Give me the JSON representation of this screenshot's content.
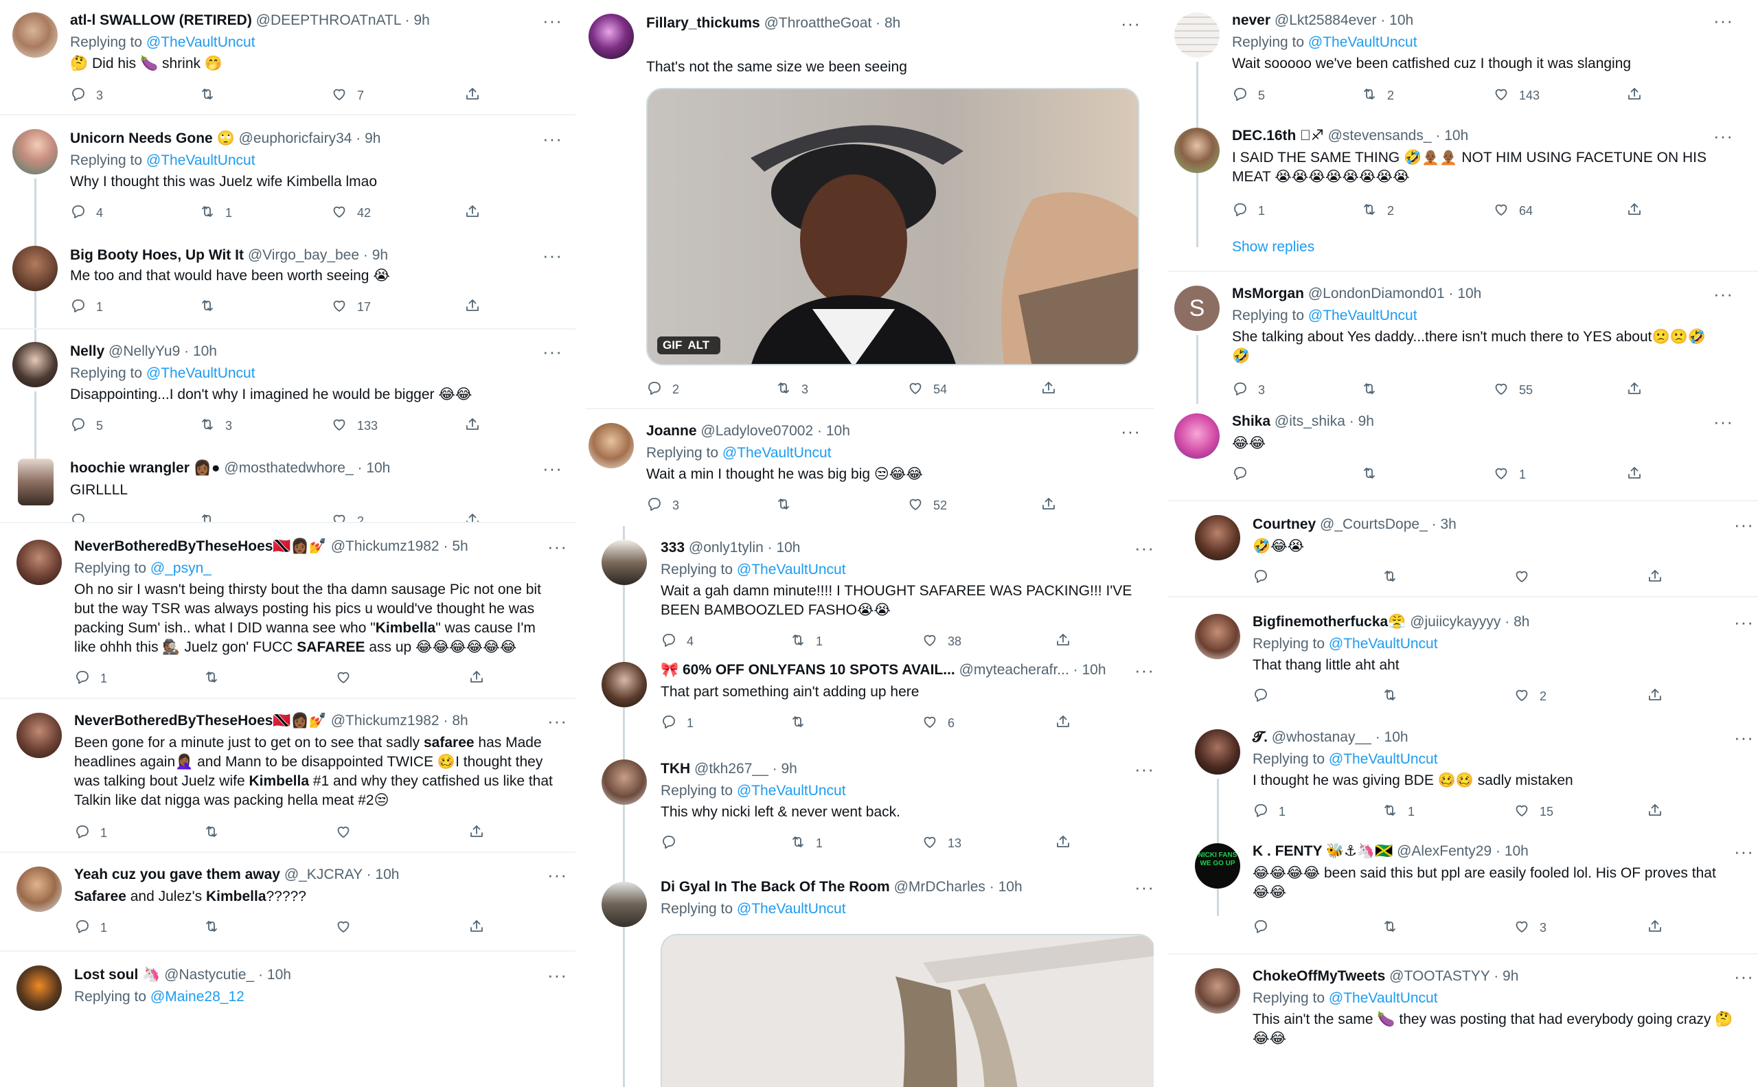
{
  "colors": {
    "link": "#1d9bf0",
    "muted": "#536471",
    "text": "#0f1419",
    "divider": "#eff3f4"
  },
  "icons": {
    "reply": "reply-icon",
    "retweet": "retweet-icon",
    "like": "heart-icon",
    "share": "share-icon",
    "more": "more-icon"
  },
  "col1": [
    {
      "name": "atl-l SWALLOW (RETIRED)",
      "handle": "@DEEPTHROATnATL",
      "time": "9h",
      "replying": "@TheVaultUncut",
      "text": "🤔 Did his 🍆 shrink 🤭",
      "replies": "3",
      "retweets": "",
      "likes": "7"
    },
    {
      "name": "Unicorn Needs Gone 🙄",
      "handle": "@euphoricfairy34",
      "time": "9h",
      "replying": "@TheVaultUncut",
      "text": "Why I thought this was Juelz wife Kimbella lmao",
      "replies": "4",
      "retweets": "1",
      "likes": "42"
    },
    {
      "name": "Big Booty Hoes, Up Wit It",
      "handle": "@Virgo_bay_bee",
      "time": "9h",
      "replying": "",
      "text": "Me too and that would have been worth seeing 😭",
      "replies": "1",
      "retweets": "",
      "likes": "17"
    },
    {
      "name": "Nelly",
      "handle": "@NellyYu9",
      "time": "10h",
      "replying": "@TheVaultUncut",
      "text": "Disappointing...I don't why I imagined he would be bigger 😂😂",
      "replies": "5",
      "retweets": "3",
      "likes": "133"
    },
    {
      "name": "hoochie wrangler 👩🏾●",
      "handle": "@mosthatedwhore_",
      "time": "10h",
      "replying": "",
      "text": "GIRLLLL",
      "replies": "",
      "retweets": "",
      "likes": "2"
    },
    {
      "name": "NeverBotheredByTheseHoes🇹🇹👩🏾💅",
      "handle": "@Thickumz1982",
      "time": "5h",
      "replying": "@_psyn_",
      "text_parts": [
        "Oh no sir I wasn't being thirsty bout the tha damn sausage Pic not one bit\nbut the way TSR was always posting his pics u would've thought he was\npacking Sum' ish.. what I DID wanna see who \"",
        "Kimbella",
        "\" was cause I'm\nlike ohhh this 🕵🏾 Juelz gon' FUCC ",
        "SAFAREE",
        " ass up 😂😂😂😂😂😂"
      ],
      "replies": "1",
      "retweets": "",
      "likes": ""
    },
    {
      "name": "NeverBotheredByTheseHoes🇹🇹👩🏾💅",
      "handle": "@Thickumz1982",
      "time": "8h",
      "replying": "",
      "text_parts": [
        "Been gone for a minute just to get on to see that sadly ",
        "safaree",
        " has Made\nheadlines again🤦🏾‍♀️ and Mann to be disappointed TWICE 🥴I thought they\nwas talking bout Juelz wife ",
        "Kimbella",
        " #1 and why they catfished us like that\nTalkin like dat nigga was packing hella meat #2😒"
      ],
      "replies": "1",
      "retweets": "",
      "likes": ""
    },
    {
      "name": "Yeah cuz you gave them away",
      "handle": "@_KJCRAY",
      "time": "10h",
      "replying": "",
      "text_parts": [
        "",
        "Safaree",
        " and Julez's ",
        "Kimbella",
        "?????"
      ],
      "replies": "1",
      "retweets": "",
      "likes": ""
    },
    {
      "name": "Lost soul 🦄",
      "handle": "@Nastycutie_",
      "time": "10h",
      "replying": "@Maine28_12",
      "text": ""
    }
  ],
  "col2": [
    {
      "name": "Fillary_thickums",
      "handle": "@ThroattheGoat",
      "time": "8h",
      "replying": "",
      "text": "That's not the same size we been seeing",
      "gif": "GIF",
      "alt": "ALT",
      "replies": "2",
      "retweets": "3",
      "likes": "54"
    },
    {
      "name": "Joanne",
      "handle": "@Ladylove07002",
      "time": "10h",
      "replying": "@TheVaultUncut",
      "text": "Wait a min I thought he was big big 😒😂😂",
      "replies": "3",
      "retweets": "",
      "likes": "52"
    },
    {
      "name": "333",
      "handle": "@only1tylin",
      "time": "10h",
      "replying": "@TheVaultUncut",
      "text": "Wait a gah damn minute!!!! I THOUGHT SAFAREE WAS PACKING!!! I'VE\nBEEN BAMBOOZLED FASHO😭😭",
      "replies": "4",
      "retweets": "1",
      "likes": "38"
    },
    {
      "name": "🎀 60% OFF ONLYFANS 10 SPOTS AVAIL...",
      "handle": "@myteacherafr...",
      "time": "10h",
      "replying": "",
      "text": "That part something ain't adding up here",
      "replies": "1",
      "retweets": "",
      "likes": "6"
    },
    {
      "name": "TKH",
      "handle": "@tkh267__",
      "time": "9h",
      "replying": "@TheVaultUncut",
      "text": "This why nicki left & never went back.",
      "replies": "",
      "retweets": "1",
      "likes": "13"
    },
    {
      "name": "Di Gyal In The Back Of The Room",
      "handle": "@MrDCharles",
      "time": "10h",
      "replying": "@TheVaultUncut",
      "text": ""
    }
  ],
  "col3": [
    {
      "name": "never",
      "handle": "@Lkt25884ever",
      "time": "10h",
      "replying": "@TheVaultUncut",
      "text": "Wait sooooo we've been catfished cuz I though it was slanging",
      "replies": "5",
      "retweets": "2",
      "likes": "143"
    },
    {
      "name": "DEC.16th 🏾♐",
      "handle": "@stevensands_",
      "time": "10h",
      "replying": "",
      "text": "I SAID THE SAME THING 🤣🧑🏾‍🦲🧑🏾‍🦲 NOT HIM USING FACETUNE ON HIS\nMEAT 😭😭😭😭😭😭😭😭",
      "replies": "1",
      "retweets": "2",
      "likes": "64",
      "show_replies": "Show replies"
    },
    {
      "name": "MsMorgan",
      "handle": "@LondonDiamond01",
      "time": "10h",
      "replying": "@TheVaultUncut",
      "text": "She talking about Yes daddy...there isn't much there to YES about🙁🙁🤣\n🤣",
      "avatar_letter": "S",
      "replies": "3",
      "retweets": "",
      "likes": "55"
    },
    {
      "name": "Shika",
      "handle": "@its_shika",
      "time": "9h",
      "replying": "",
      "text": "😂😂",
      "replies": "",
      "retweets": "",
      "likes": "1"
    },
    {
      "name": "Courtney",
      "handle": "@_CourtsDope_",
      "time": "3h",
      "replying": "",
      "text": "🤣😂😭",
      "replies": "",
      "retweets": "",
      "likes": ""
    },
    {
      "name": "Bigfinemotherfucka😤",
      "handle": "@juiicykayyyy",
      "time": "8h",
      "replying": "@TheVaultUncut",
      "text": "That thang little aht aht",
      "replies": "",
      "retweets": "",
      "likes": "2"
    },
    {
      "name": "𝓣.",
      "handle": "@whostanay__",
      "time": "10h",
      "replying": "@TheVaultUncut",
      "text": "I thought he was giving BDE 🥴🥴 sadly mistaken",
      "replies": "1",
      "retweets": "1",
      "likes": "15"
    },
    {
      "name": "K . FENTY 🐝⚓🦄🇯🇲",
      "handle": "@AlexFenty29",
      "time": "10h",
      "replying": "",
      "text": "😂😂😂😂 been said this but ppl are easily fooled lol. His OF proves that\n😂😂",
      "avatar_text": "NICKI FANS WE GO UP",
      "replies": "",
      "retweets": "",
      "likes": "3"
    },
    {
      "name": "ChokeOffMyTweets",
      "handle": "@TOOTASTYY",
      "time": "9h",
      "replying": "@TheVaultUncut",
      "text": "This ain't the same 🍆 they was posting that had everybody going crazy 🤔\n😂😂"
    }
  ],
  "labels": {
    "replying_to": "Replying to",
    "dot": "·"
  }
}
